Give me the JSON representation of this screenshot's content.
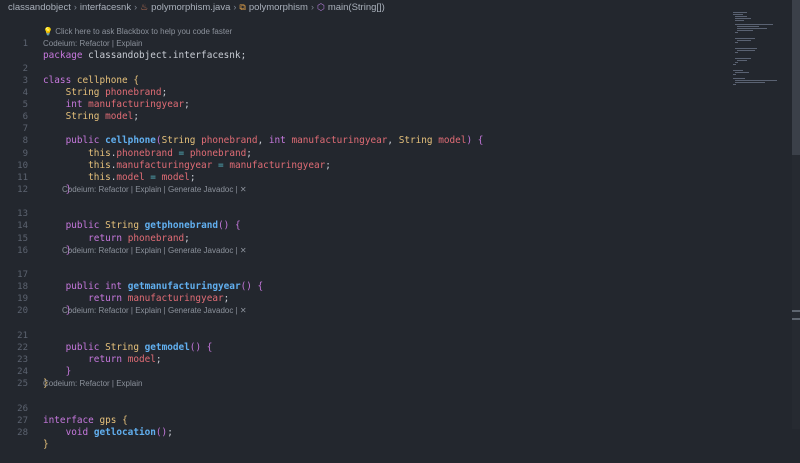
{
  "breadcrumb": {
    "items": [
      "classandobject",
      "interfacesnk",
      "polymorphism.java",
      "polymorphism",
      "main(String[])"
    ]
  },
  "hint": {
    "text": "Click here to ask Blackbox to help you code faster"
  },
  "codelens": {
    "refactor_explain": "Codeium: Refactor | Explain",
    "refactor_explain_javadoc": "Codeium: Refactor | Explain | Generate Javadoc | ✕"
  },
  "code": {
    "l1_kw": "package",
    "l1_pkg": "classandobject.interfacesnk",
    "l2_kw": "class",
    "l2_name": "cellphone",
    "l3_type": "String",
    "l3_var": "phonebrand",
    "l4_type": "int",
    "l4_var": "manufacturingyear",
    "l5_type": "String",
    "l5_var": "model",
    "l7_kw": "public",
    "l7_name": "cellphone",
    "l7_t1": "String",
    "l7_p1": "phonebrand",
    "l7_t2": "int",
    "l7_p2": "manufacturingyear",
    "l7_t3": "String",
    "l7_p3": "model",
    "this_kw": "this",
    "l8_field": "phonebrand",
    "l8_rhs": "phonebrand",
    "l9_field": "manufacturingyear",
    "l9_rhs": "manufacturingyear",
    "l10_field": "model",
    "l10_rhs": "model",
    "public_kw": "public",
    "return_kw": "return",
    "string_type": "String",
    "int_type": "int",
    "l13_name": "getphonebrand",
    "l14_ret": "phonebrand",
    "l17_name": "getmanufacturingyear",
    "l18_ret": "manufacturingyear",
    "l21_name": "getmodel",
    "l22_ret": "model",
    "l26_kw": "interface",
    "l26_name": "gps",
    "l27_kw": "void",
    "l27_name": "getlocation"
  },
  "colors": {
    "background": "#23272e",
    "keyword": "#c678dd",
    "type": "#e5c07b",
    "variable": "#e06c75",
    "function": "#61afef"
  }
}
